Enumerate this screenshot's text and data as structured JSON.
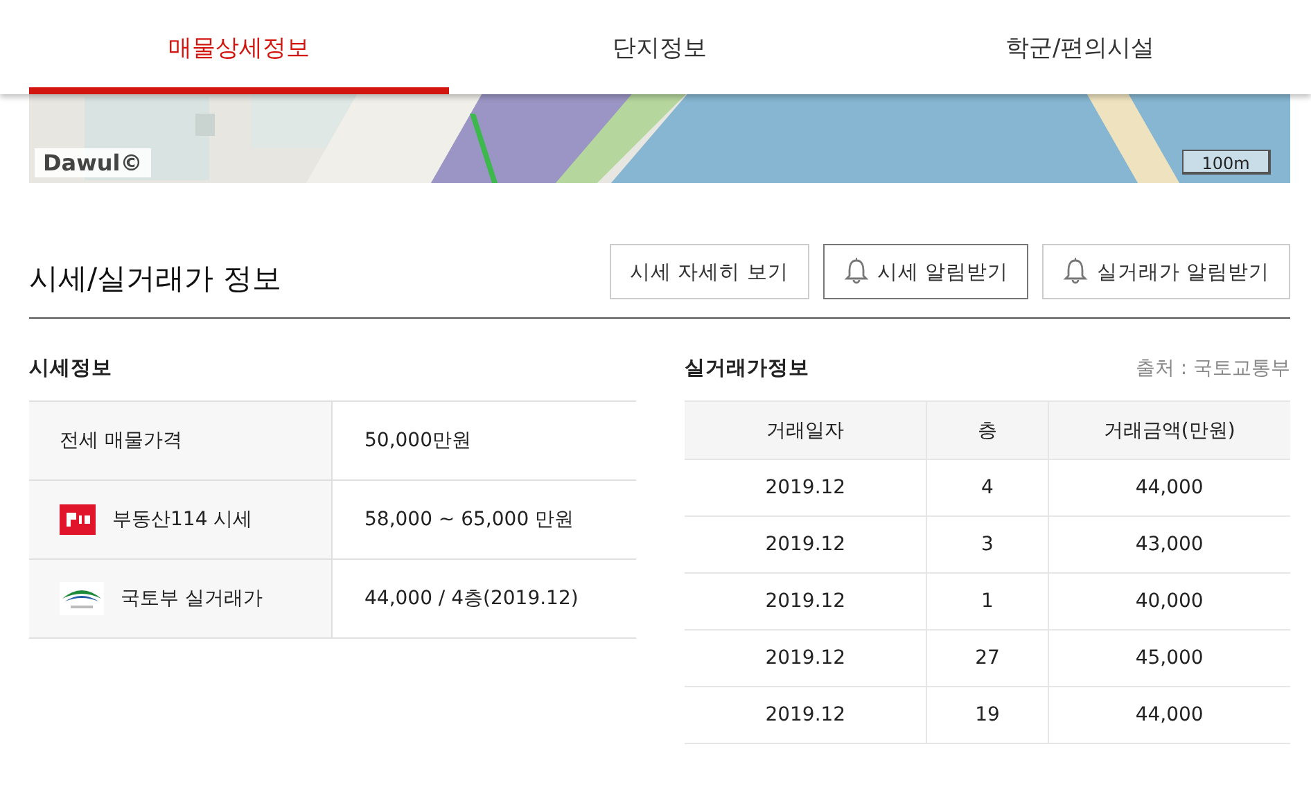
{
  "tabs": [
    {
      "label": "매물상세정보",
      "selected": true
    },
    {
      "label": "단지정보",
      "selected": false
    },
    {
      "label": "학군/편의시설",
      "selected": false
    }
  ],
  "map": {
    "kind": "picture",
    "logo": "Dawul©",
    "scale": "100m"
  },
  "section": {
    "title": "시세/실거래가 정보",
    "buttons": [
      {
        "label": "시세 자세히 보기",
        "kind": "plain",
        "selected": false
      },
      {
        "label": "시세 알림받기",
        "kind": "alert",
        "selected": true
      },
      {
        "label": "실거래가 알림받기",
        "kind": "alert",
        "selected": false
      }
    ]
  },
  "price_info": {
    "title": "시세정보",
    "rows": [
      {
        "kind": "plain",
        "label": "전세 매물가격",
        "value": "50,000만원"
      },
      {
        "kind": "brand",
        "label": "부동산114 시세",
        "value": "58,000 ~ 65,000 만원"
      },
      {
        "kind": "ministry",
        "label": "국토부 실거래가",
        "value": "44,000 / 4층(2019.12)"
      }
    ]
  },
  "transactions": {
    "title": "실거래가정보",
    "source": "출처 : 국토교통부",
    "columns": [
      "거래일자",
      "층",
      "거래금액(만원)"
    ],
    "rows": [
      [
        "2019.12",
        "4",
        "44,000"
      ],
      [
        "2019.12",
        "3",
        "43,000"
      ],
      [
        "2019.12",
        "1",
        "40,000"
      ],
      [
        "2019.12",
        "27",
        "45,000"
      ],
      [
        "2019.12",
        "19",
        "44,000"
      ]
    ]
  }
}
